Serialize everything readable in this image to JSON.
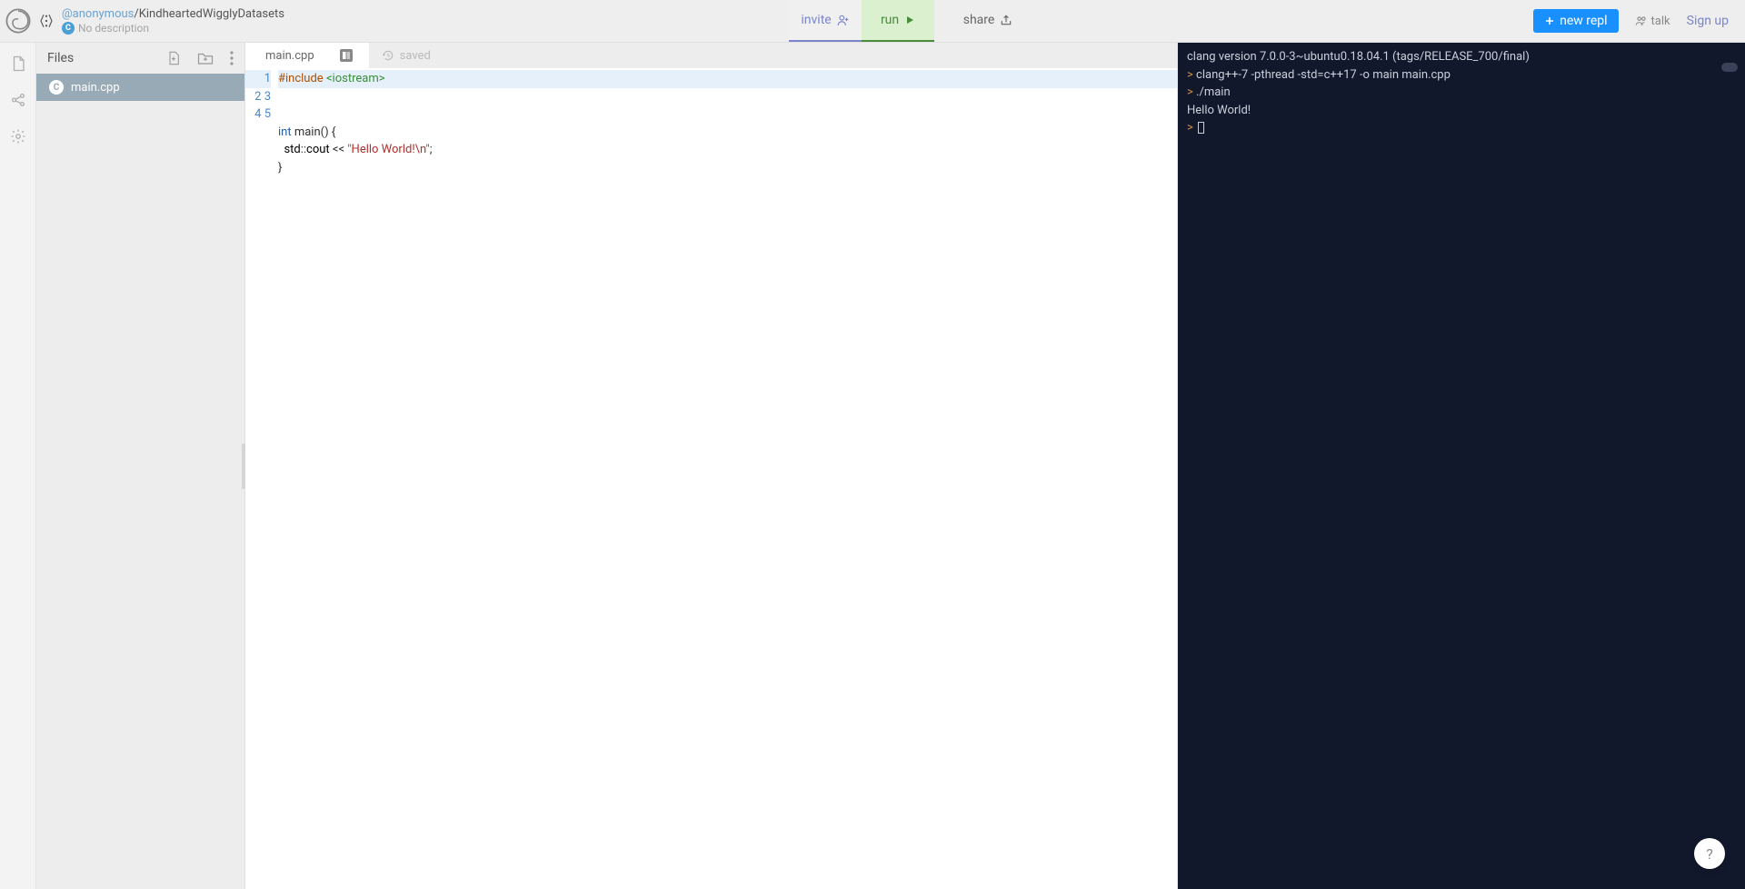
{
  "header": {
    "owner": "@anonymous",
    "separator": "/",
    "repl_name": "KindheartedWigglyDatasets",
    "language_badge": "C",
    "description": "No description",
    "invite_label": "invite",
    "run_label": "run",
    "share_label": "share",
    "new_repl_label": "new repl",
    "talk_label": "talk",
    "signup_label": "Sign up"
  },
  "files_panel": {
    "title": "Files",
    "items": [
      {
        "name": "main.cpp",
        "active": true
      }
    ]
  },
  "editor": {
    "tab_name": "main.cpp",
    "saved_label": "saved",
    "lines": [
      "1",
      "2",
      "3",
      "4",
      "5"
    ]
  },
  "terminal": {
    "line1": "clang version 7.0.0-3~ubuntu0.18.04.1 (tags/RELEASE_700/final)",
    "line2_cmd": "clang++-7 -pthread -std=c++17 -o main main.cpp",
    "line3_cmd": "./main",
    "line4_out": "Hello World!"
  },
  "help": {
    "label": "?"
  }
}
